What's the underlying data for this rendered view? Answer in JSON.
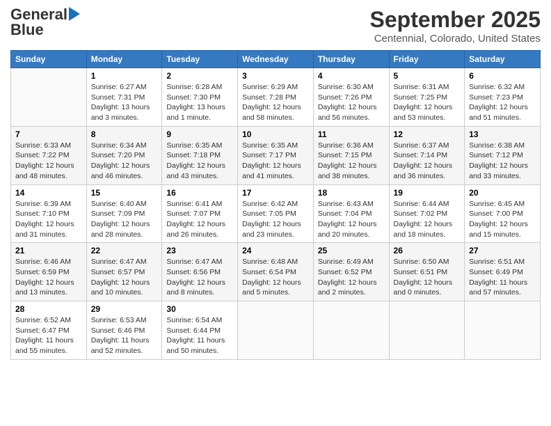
{
  "logo": {
    "line1": "General",
    "line2": "Blue"
  },
  "title": "September 2025",
  "subtitle": "Centennial, Colorado, United States",
  "weekdays": [
    "Sunday",
    "Monday",
    "Tuesday",
    "Wednesday",
    "Thursday",
    "Friday",
    "Saturday"
  ],
  "weeks": [
    [
      {
        "day": "",
        "info": ""
      },
      {
        "day": "1",
        "info": "Sunrise: 6:27 AM\nSunset: 7:31 PM\nDaylight: 13 hours\nand 3 minutes."
      },
      {
        "day": "2",
        "info": "Sunrise: 6:28 AM\nSunset: 7:30 PM\nDaylight: 13 hours\nand 1 minute."
      },
      {
        "day": "3",
        "info": "Sunrise: 6:29 AM\nSunset: 7:28 PM\nDaylight: 12 hours\nand 58 minutes."
      },
      {
        "day": "4",
        "info": "Sunrise: 6:30 AM\nSunset: 7:26 PM\nDaylight: 12 hours\nand 56 minutes."
      },
      {
        "day": "5",
        "info": "Sunrise: 6:31 AM\nSunset: 7:25 PM\nDaylight: 12 hours\nand 53 minutes."
      },
      {
        "day": "6",
        "info": "Sunrise: 6:32 AM\nSunset: 7:23 PM\nDaylight: 12 hours\nand 51 minutes."
      }
    ],
    [
      {
        "day": "7",
        "info": "Sunrise: 6:33 AM\nSunset: 7:22 PM\nDaylight: 12 hours\nand 48 minutes."
      },
      {
        "day": "8",
        "info": "Sunrise: 6:34 AM\nSunset: 7:20 PM\nDaylight: 12 hours\nand 46 minutes."
      },
      {
        "day": "9",
        "info": "Sunrise: 6:35 AM\nSunset: 7:18 PM\nDaylight: 12 hours\nand 43 minutes."
      },
      {
        "day": "10",
        "info": "Sunrise: 6:35 AM\nSunset: 7:17 PM\nDaylight: 12 hours\nand 41 minutes."
      },
      {
        "day": "11",
        "info": "Sunrise: 6:36 AM\nSunset: 7:15 PM\nDaylight: 12 hours\nand 38 minutes."
      },
      {
        "day": "12",
        "info": "Sunrise: 6:37 AM\nSunset: 7:14 PM\nDaylight: 12 hours\nand 36 minutes."
      },
      {
        "day": "13",
        "info": "Sunrise: 6:38 AM\nSunset: 7:12 PM\nDaylight: 12 hours\nand 33 minutes."
      }
    ],
    [
      {
        "day": "14",
        "info": "Sunrise: 6:39 AM\nSunset: 7:10 PM\nDaylight: 12 hours\nand 31 minutes."
      },
      {
        "day": "15",
        "info": "Sunrise: 6:40 AM\nSunset: 7:09 PM\nDaylight: 12 hours\nand 28 minutes."
      },
      {
        "day": "16",
        "info": "Sunrise: 6:41 AM\nSunset: 7:07 PM\nDaylight: 12 hours\nand 26 minutes."
      },
      {
        "day": "17",
        "info": "Sunrise: 6:42 AM\nSunset: 7:05 PM\nDaylight: 12 hours\nand 23 minutes."
      },
      {
        "day": "18",
        "info": "Sunrise: 6:43 AM\nSunset: 7:04 PM\nDaylight: 12 hours\nand 20 minutes."
      },
      {
        "day": "19",
        "info": "Sunrise: 6:44 AM\nSunset: 7:02 PM\nDaylight: 12 hours\nand 18 minutes."
      },
      {
        "day": "20",
        "info": "Sunrise: 6:45 AM\nSunset: 7:00 PM\nDaylight: 12 hours\nand 15 minutes."
      }
    ],
    [
      {
        "day": "21",
        "info": "Sunrise: 6:46 AM\nSunset: 6:59 PM\nDaylight: 12 hours\nand 13 minutes."
      },
      {
        "day": "22",
        "info": "Sunrise: 6:47 AM\nSunset: 6:57 PM\nDaylight: 12 hours\nand 10 minutes."
      },
      {
        "day": "23",
        "info": "Sunrise: 6:47 AM\nSunset: 6:56 PM\nDaylight: 12 hours\nand 8 minutes."
      },
      {
        "day": "24",
        "info": "Sunrise: 6:48 AM\nSunset: 6:54 PM\nDaylight: 12 hours\nand 5 minutes."
      },
      {
        "day": "25",
        "info": "Sunrise: 6:49 AM\nSunset: 6:52 PM\nDaylight: 12 hours\nand 2 minutes."
      },
      {
        "day": "26",
        "info": "Sunrise: 6:50 AM\nSunset: 6:51 PM\nDaylight: 12 hours\nand 0 minutes."
      },
      {
        "day": "27",
        "info": "Sunrise: 6:51 AM\nSunset: 6:49 PM\nDaylight: 11 hours\nand 57 minutes."
      }
    ],
    [
      {
        "day": "28",
        "info": "Sunrise: 6:52 AM\nSunset: 6:47 PM\nDaylight: 11 hours\nand 55 minutes."
      },
      {
        "day": "29",
        "info": "Sunrise: 6:53 AM\nSunset: 6:46 PM\nDaylight: 11 hours\nand 52 minutes."
      },
      {
        "day": "30",
        "info": "Sunrise: 6:54 AM\nSunset: 6:44 PM\nDaylight: 11 hours\nand 50 minutes."
      },
      {
        "day": "",
        "info": ""
      },
      {
        "day": "",
        "info": ""
      },
      {
        "day": "",
        "info": ""
      },
      {
        "day": "",
        "info": ""
      }
    ]
  ]
}
